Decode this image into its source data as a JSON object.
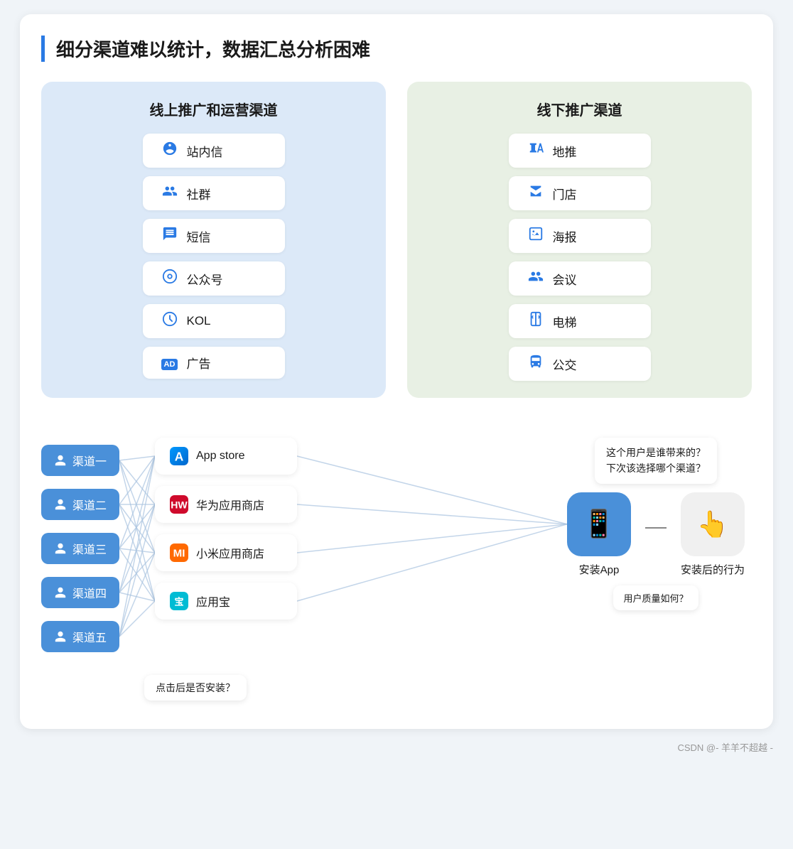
{
  "title": "细分渠道难以统计，数据汇总分析困难",
  "online_panel": {
    "title": "线上推广和运营渠道",
    "channels": [
      {
        "icon": "🔔",
        "label": "站内信"
      },
      {
        "icon": "👤",
        "label": "社群"
      },
      {
        "icon": "💬",
        "label": "短信"
      },
      {
        "icon": "💚",
        "label": "公众号"
      },
      {
        "icon": "🔍",
        "label": "KOL"
      },
      {
        "icon": "🅰",
        "label": "广告"
      }
    ]
  },
  "offline_panel": {
    "title": "线下推广渠道",
    "channels": [
      {
        "icon": "📣",
        "label": "地推"
      },
      {
        "icon": "🏬",
        "label": "门店"
      },
      {
        "icon": "🖼",
        "label": "海报"
      },
      {
        "icon": "👥",
        "label": "会议"
      },
      {
        "icon": "🛗",
        "label": "电梯"
      },
      {
        "icon": "🚌",
        "label": "公交"
      }
    ]
  },
  "source_channels": [
    {
      "label": "渠道一"
    },
    {
      "label": "渠道二"
    },
    {
      "label": "渠道三"
    },
    {
      "label": "渠道四"
    },
    {
      "label": "渠道五"
    }
  ],
  "app_stores": [
    {
      "label": "App store",
      "icon": "app_store"
    },
    {
      "label": "华为应用商店",
      "icon": "huawei"
    },
    {
      "label": "小米应用商店",
      "icon": "xiaomi"
    },
    {
      "label": "应用宝",
      "icon": "yingyongbao"
    }
  ],
  "speech_bubble": "这个用户是谁带来的？\n下次该选择哪个渠道？",
  "install_app_label": "安装App",
  "install_behavior_label": "安装后的行为",
  "quality_bubble": "用户质量如何？",
  "click_bubble": "点击后是否安装？",
  "watermark": "CSDN @- 羊羊不超越 -"
}
